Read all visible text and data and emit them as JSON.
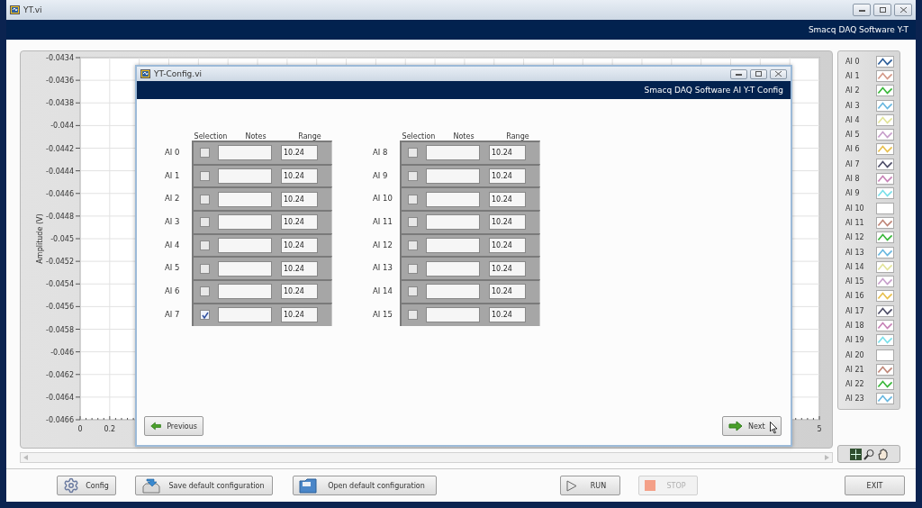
{
  "window": {
    "title": "YT.vi",
    "header": "Smacq DAQ Software Y-T"
  },
  "chart": {
    "ylabel": "Amplitude (V)",
    "yticks": [
      "-0.0434",
      "-0.0436",
      "-0.0438",
      "-0.044",
      "-0.0442",
      "-0.0444",
      "-0.0446",
      "-0.0448",
      "-0.045",
      "-0.0452",
      "-0.0454",
      "-0.0456",
      "-0.0458",
      "-0.046",
      "-0.0462",
      "-0.0464",
      "-0.0466"
    ],
    "xticks": [
      "0",
      "0.2",
      "5"
    ]
  },
  "legend": [
    {
      "label": "AI 0",
      "color": "#2f5f9a"
    },
    {
      "label": "AI 1",
      "color": "#d49a8a"
    },
    {
      "label": "AI 2",
      "color": "#3cb83c"
    },
    {
      "label": "AI 3",
      "color": "#6ab8e0"
    },
    {
      "label": "AI 4",
      "color": "#e2e49a"
    },
    {
      "label": "AI 5",
      "color": "#c8a0cc"
    },
    {
      "label": "AI 6",
      "color": "#e8c050"
    },
    {
      "label": "AI 7",
      "color": "#50506a"
    },
    {
      "label": "AI 8",
      "color": "#c884b8"
    },
    {
      "label": "AI 9",
      "color": "#7ce0ea"
    },
    {
      "label": "AI 10"
    },
    {
      "label": "AI 11",
      "color": "#c0887a"
    },
    {
      "label": "AI 12",
      "color": "#3cb83c"
    },
    {
      "label": "AI 13",
      "color": "#6ab8e0"
    },
    {
      "label": "AI 14",
      "color": "#e2e49a"
    },
    {
      "label": "AI 15",
      "color": "#c8a0cc"
    },
    {
      "label": "AI 16",
      "color": "#e8c050"
    },
    {
      "label": "AI 17",
      "color": "#50506a"
    },
    {
      "label": "AI 18",
      "color": "#c884b8"
    },
    {
      "label": "AI 19",
      "color": "#7ce0ea"
    },
    {
      "label": "AI 20"
    },
    {
      "label": "AI 21",
      "color": "#c0887a"
    },
    {
      "label": "AI 22",
      "color": "#3cb83c"
    },
    {
      "label": "AI 23",
      "color": "#6ab8e0"
    }
  ],
  "dialog": {
    "title": "YT-Config.vi",
    "header": "Smacq DAQ Software AI Y-T Config",
    "groups": [
      {
        "columns": [
          "Selection",
          "Notes",
          "Range"
        ],
        "rows": [
          {
            "label": "AI 0",
            "checked": false,
            "range": "10.24"
          },
          {
            "label": "AI 1",
            "checked": false,
            "range": "10.24"
          },
          {
            "label": "AI 2",
            "checked": false,
            "range": "10.24"
          },
          {
            "label": "AI 3",
            "checked": false,
            "range": "10.24"
          },
          {
            "label": "AI 4",
            "checked": false,
            "range": "10.24"
          },
          {
            "label": "AI 5",
            "checked": false,
            "range": "10.24"
          },
          {
            "label": "AI 6",
            "checked": false,
            "range": "10.24"
          },
          {
            "label": "AI 7",
            "checked": true,
            "range": "10.24"
          }
        ]
      },
      {
        "columns": [
          "Selection",
          "Notes",
          "Range"
        ],
        "rows": [
          {
            "label": "AI 8",
            "checked": false,
            "range": "10.24"
          },
          {
            "label": "AI 9",
            "checked": false,
            "range": "10.24"
          },
          {
            "label": "AI 10",
            "checked": false,
            "range": "10.24"
          },
          {
            "label": "AI 11",
            "checked": false,
            "range": "10.24"
          },
          {
            "label": "AI 12",
            "checked": false,
            "range": "10.24"
          },
          {
            "label": "AI 13",
            "checked": false,
            "range": "10.24"
          },
          {
            "label": "AI 14",
            "checked": false,
            "range": "10.24"
          },
          {
            "label": "AI 15",
            "checked": false,
            "range": "10.24"
          }
        ]
      }
    ],
    "buttons": [
      {
        "label": "Previous",
        "kind": "previous"
      },
      {
        "label": "Next",
        "kind": "next"
      }
    ]
  },
  "toolbar": [
    {
      "label": "Config",
      "kind": "config",
      "disabled": false
    },
    {
      "label": "Save default configuration",
      "kind": "save",
      "disabled": false
    },
    {
      "label": "Open default configuration",
      "kind": "open",
      "disabled": false
    },
    {
      "label": "RUN",
      "kind": "run",
      "disabled": false
    },
    {
      "label": "STOP",
      "kind": "stop",
      "disabled": true
    },
    {
      "label": "EXIT",
      "kind": "exit",
      "disabled": false
    }
  ]
}
